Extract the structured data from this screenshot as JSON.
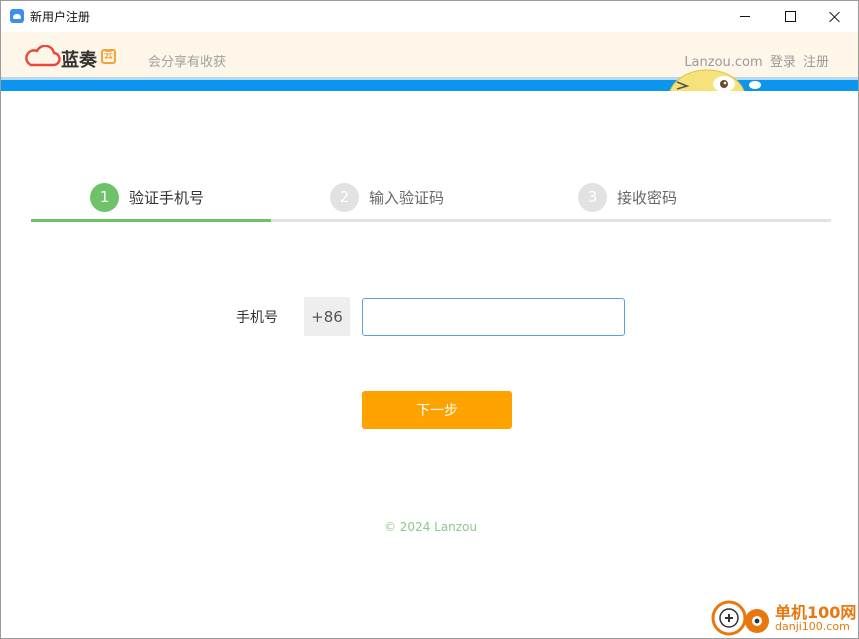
{
  "window": {
    "title": "新用户注册"
  },
  "header": {
    "logo_text": "蓝奏",
    "logo_badge": "云",
    "tagline": "会分享有收获",
    "site_name": "Lanzou.com",
    "login_label": "登录",
    "register_label": "注册"
  },
  "steps": [
    {
      "number": "1",
      "label": "验证手机号",
      "active": true
    },
    {
      "number": "2",
      "label": "输入验证码",
      "active": false
    },
    {
      "number": "3",
      "label": "接收密码",
      "active": false
    }
  ],
  "form": {
    "phone_label": "手机号",
    "country_code": "+86",
    "phone_value": "",
    "next_button_label": "下一步"
  },
  "footer": {
    "copyright": "© 2024 Lanzou"
  },
  "watermark": {
    "brand": "单机100网",
    "url": "danji100.com"
  },
  "colors": {
    "accent_green": "#6ec26a",
    "accent_orange": "#fea200",
    "header_bg": "#fff6ea",
    "band_blue": "#0a96ee"
  },
  "icons": {
    "app_icon": "cloud-app-icon",
    "minimize": "minimize-icon",
    "maximize": "maximize-icon",
    "close": "close-icon",
    "logo": "lanzou-cloud-logo-icon"
  }
}
